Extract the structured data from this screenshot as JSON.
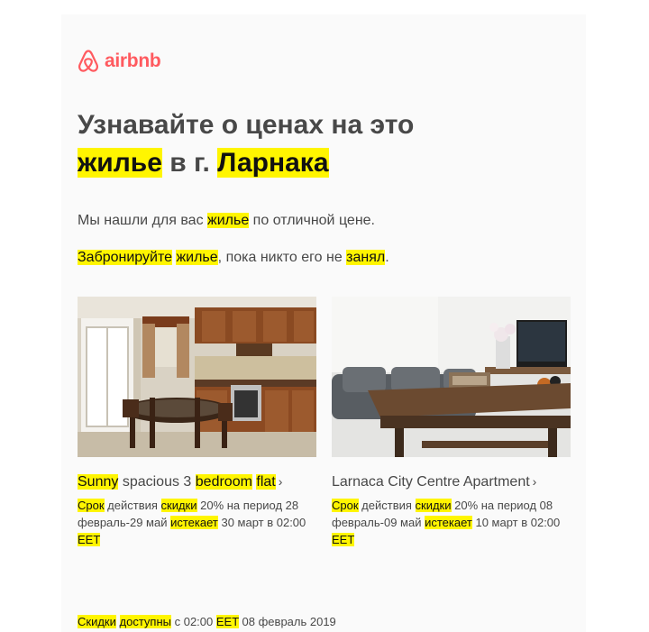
{
  "brand": {
    "name": "airbnb",
    "color": "#ff5a5f"
  },
  "highlight_color": "#fff500",
  "headline": [
    {
      "text": "Узнавайте о ценах на это ",
      "hl": false
    },
    {
      "text": "жилье",
      "hl": true
    },
    {
      "text": " в г. ",
      "hl": false
    },
    {
      "text": "Ларнака",
      "hl": true
    }
  ],
  "intro": [
    {
      "text": "Мы нашли для вас ",
      "hl": false
    },
    {
      "text": "жилье",
      "hl": true
    },
    {
      "text": " по отличной цене.",
      "hl": false
    }
  ],
  "cta": [
    {
      "text": "Забронируйте",
      "hl": true
    },
    {
      "text": " ",
      "hl": false
    },
    {
      "text": "жилье",
      "hl": true
    },
    {
      "text": ", пока никто его не ",
      "hl": false
    },
    {
      "text": "занял",
      "hl": true
    },
    {
      "text": ".",
      "hl": false
    }
  ],
  "listings": [
    {
      "photo_icon": "kitchen-photo",
      "title": [
        {
          "text": "Sunny",
          "hl": true
        },
        {
          "text": " spacious 3 ",
          "hl": false
        },
        {
          "text": "bedroom",
          "hl": true
        },
        {
          "text": " ",
          "hl": false
        },
        {
          "text": "flat",
          "hl": true
        }
      ],
      "chevron": "›",
      "desc": [
        {
          "text": "Срок",
          "hl": true
        },
        {
          "text": " действия ",
          "hl": false
        },
        {
          "text": "скидки",
          "hl": true
        },
        {
          "text": " 20% на период 28 февраль-29 май ",
          "hl": false
        },
        {
          "text": "истекает",
          "hl": true
        },
        {
          "text": " 30 март в 02:00 ",
          "hl": false
        },
        {
          "text": "EET",
          "hl": true
        }
      ]
    },
    {
      "photo_icon": "living-room-photo",
      "title": [
        {
          "text": "Larnaca City Centre Apartment",
          "hl": false
        }
      ],
      "chevron": "›",
      "desc": [
        {
          "text": "Срок",
          "hl": true
        },
        {
          "text": " действия ",
          "hl": false
        },
        {
          "text": "скидки",
          "hl": true
        },
        {
          "text": " 20% на период 08 февраль-09 май ",
          "hl": false
        },
        {
          "text": "истекает",
          "hl": true
        },
        {
          "text": " 10 март в 02:00 ",
          "hl": false
        },
        {
          "text": "EET",
          "hl": true
        }
      ]
    }
  ],
  "footer": [
    {
      "text": "Скидки",
      "hl": true
    },
    {
      "text": " ",
      "hl": false
    },
    {
      "text": "доступны",
      "hl": true
    },
    {
      "text": " с 02:00 ",
      "hl": false
    },
    {
      "text": "EET",
      "hl": true
    },
    {
      "text": " 08 февраль 2019",
      "hl": false
    }
  ]
}
